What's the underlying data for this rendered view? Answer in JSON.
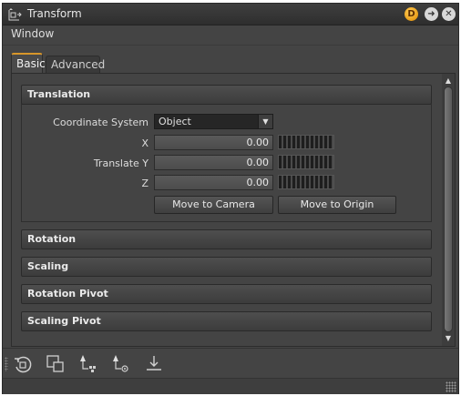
{
  "window": {
    "title": "Transform",
    "buttons": {
      "dock": "D",
      "arrow": "➜",
      "close": "✕"
    }
  },
  "menu": {
    "window": "Window"
  },
  "tabs": [
    {
      "label": "Basic",
      "active": true
    },
    {
      "label": "Advanced",
      "active": false
    }
  ],
  "sections": {
    "translation": "Translation",
    "rotation": "Rotation",
    "scaling": "Scaling",
    "rotation_pivot": "Rotation Pivot",
    "scaling_pivot": "Scaling Pivot"
  },
  "translation": {
    "coordinate_system_label": "Coordinate System",
    "coordinate_system_value": "Object",
    "x_label": "X",
    "y_label": "Translate Y",
    "z_label": "Z",
    "x_value": "0.00",
    "y_value": "0.00",
    "z_value": "0.00",
    "move_to_camera": "Move to Camera",
    "move_to_origin": "Move to Origin"
  },
  "toolbar": {
    "icons": [
      "reset-icon",
      "frame-icon",
      "pivot-to-selection-icon",
      "pivot-to-center-icon",
      "drop-to-ground-icon"
    ]
  },
  "colors": {
    "accent": "#d8962a",
    "panel": "#444444",
    "field": "#262626"
  }
}
